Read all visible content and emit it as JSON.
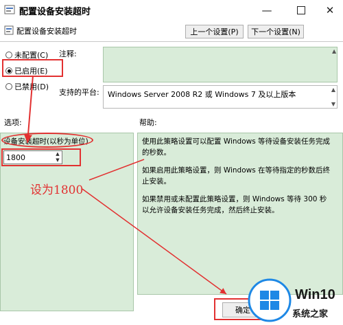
{
  "window": {
    "title": "配置设备安装超时",
    "controls": [
      "minimize-icon",
      "maximize-icon",
      "close-icon"
    ]
  },
  "toolbar": {
    "policy_name": "配置设备安装超时",
    "prev_button": "上一个设置(P)",
    "next_button": "下一个设置(N)"
  },
  "state": {
    "options": [
      {
        "label": "未配置(C)",
        "selected": false
      },
      {
        "label": "已启用(E)",
        "selected": true
      },
      {
        "label": "已禁用(D)",
        "selected": false
      }
    ]
  },
  "comment": {
    "label": "注释:",
    "value": ""
  },
  "platform": {
    "label": "支持的平台:",
    "value": "Windows Server 2008 R2 或 Windows 7 及以上版本"
  },
  "options_pane": {
    "header": "选项:",
    "timeout_label": "设备安装超时(以秒为单位)",
    "timeout_value": "1800"
  },
  "help_pane": {
    "header": "帮助:",
    "paragraphs": [
      "使用此策略设置可以配置 Windows 等待设备安装任务完成的秒数。",
      "如果启用此策略设置，则 Windows 在等待指定的秒数后终止安装。",
      "如果禁用或未配置此策略设置，则 Windows 等待 300 秒以允许设备安装任务完成，然后终止安装。"
    ]
  },
  "footer": {
    "ok_button": "确定"
  },
  "annotation": {
    "text": "设为1800",
    "color": "#e23030"
  },
  "watermark": {
    "brand": "Win10",
    "sub": "系统之家"
  },
  "colors": {
    "green_panel": "#d9ecd9",
    "annotation_red": "#e23030",
    "win_blue": "#1e88e5"
  }
}
